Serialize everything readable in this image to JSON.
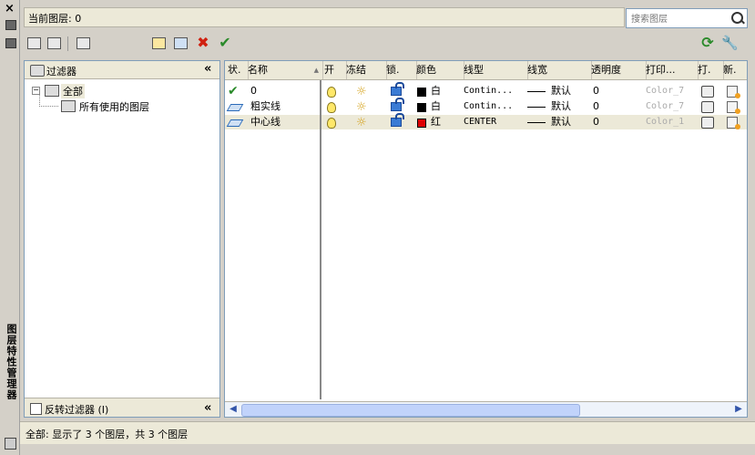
{
  "strip": {
    "close": "×",
    "vertical_title": "图层特性管理器"
  },
  "current_layer": {
    "text": "当前图层: 0"
  },
  "search": {
    "placeholder": "搜索图层"
  },
  "filter_panel": {
    "title": "过滤器",
    "collapse": "«",
    "tree": [
      {
        "label": "全部",
        "expand": "⊟"
      },
      {
        "label": "所有使用的图层"
      }
    ],
    "invert_label": "反转过滤器 (I)"
  },
  "columns": [
    "状.",
    "名称",
    "开",
    "冻结",
    "锁.",
    "颜色",
    "线型",
    "线宽",
    "透明度",
    "打印...",
    "打.",
    "新."
  ],
  "sort_arrow": "▲",
  "layers": [
    {
      "name": "0",
      "color_name": "白",
      "color_hex": "#000000",
      "linetype": "Contin...",
      "lineweight": "默认",
      "transparency": "0",
      "plot_style": "Color_7",
      "status": "current"
    },
    {
      "name": "粗实线",
      "color_name": "白",
      "color_hex": "#000000",
      "linetype": "Contin...",
      "lineweight": "默认",
      "transparency": "0",
      "plot_style": "Color_7",
      "status": "layer"
    },
    {
      "name": "中心线",
      "color_name": "红",
      "color_hex": "#dd0000",
      "linetype": "CENTER",
      "lineweight": "默认",
      "transparency": "0",
      "plot_style": "Color_1",
      "status": "layer"
    }
  ],
  "status_bar": {
    "text": "全部: 显示了 3 个图层，共 3 个图层"
  },
  "icons": {
    "sun": "☼",
    "check": "✔",
    "delete": "✖",
    "refresh": "⟳",
    "settings": "🔧"
  },
  "scroll": {
    "left": "◀",
    "right": "▶"
  }
}
